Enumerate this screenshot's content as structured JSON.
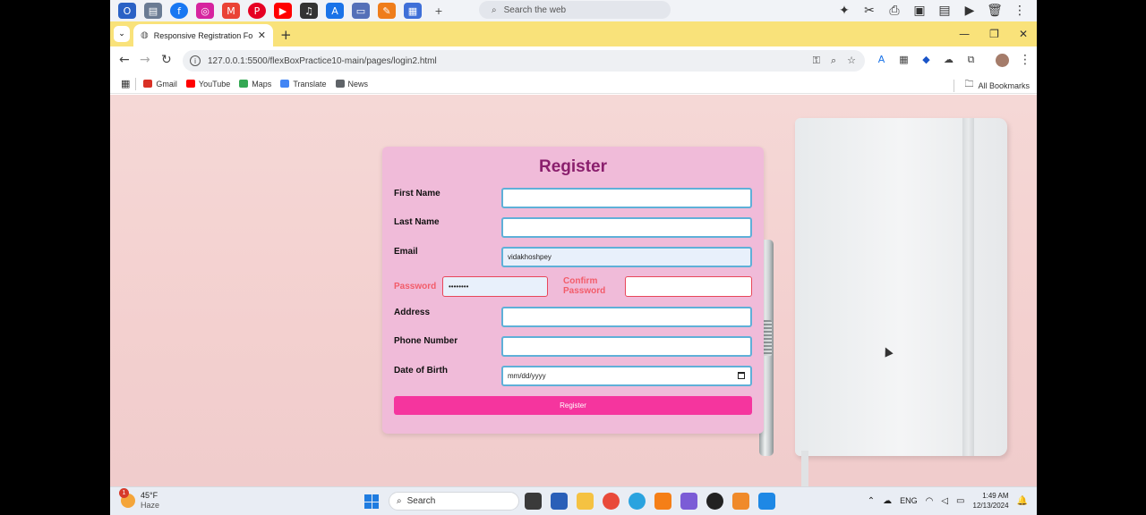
{
  "top_taskbar": {
    "search_placeholder": "Search the web"
  },
  "browser": {
    "tab_title": "Responsive Registration Form",
    "url": "127.0.0.1:5500/flexBoxPractice10-main/pages/login2.html",
    "bookmarks": [
      {
        "label": "Gmail",
        "color": "#d93025"
      },
      {
        "label": "YouTube",
        "color": "#ff0000"
      },
      {
        "label": "Maps",
        "color": "#34a853"
      },
      {
        "label": "Translate",
        "color": "#4285f4"
      },
      {
        "label": "News",
        "color": "#5f6368"
      }
    ],
    "all_bookmarks_label": "All Bookmarks"
  },
  "form": {
    "title": "Register",
    "first_name_label": "First Name",
    "last_name_label": "Last Name",
    "email_label": "Email",
    "email_value": "vidakhoshpey",
    "password_label": "Password",
    "password_value": "••••••••",
    "confirm_password_label": "Confirm Password",
    "address_label": "Address",
    "phone_label": "Phone Number",
    "dob_label": "Date of Birth",
    "dob_placeholder": "mm/dd/yyyy",
    "submit_label": "Register",
    "colors": {
      "title": "#8a1f6d",
      "button": "#f5359e",
      "card": "#f0bbd9",
      "error": "#f25c6a"
    }
  },
  "taskbar": {
    "weather_temp": "45°F",
    "weather_desc": "Haze",
    "weather_badge": "1",
    "search_label": "Search",
    "language": "ENG",
    "time": "1:49 AM",
    "date": "12/13/2024"
  }
}
